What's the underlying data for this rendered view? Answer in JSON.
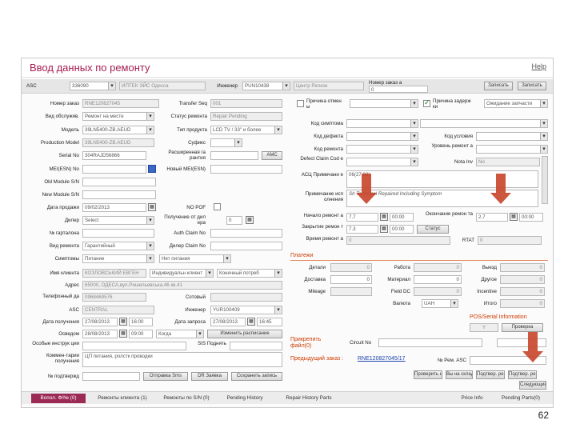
{
  "window": {
    "title": "Ввод данных по ремонту",
    "help": "Help"
  },
  "topbar": {
    "asc_label": "ASC",
    "asc_code": "336090",
    "asc_name": "ИПТЕК ЭЙС Одесса",
    "engineer_label": "Инженер",
    "engineer_code": "PUN10438",
    "engineer_name": "Центр Регион",
    "order_label": "Номер заказ а",
    "order_value": "0",
    "btn1": "Записать",
    "btn2": "Записать"
  },
  "left": {
    "claim_no_label": "Номер заказ",
    "claim_no": "RNE120827045",
    "transfer_label": "Transfer Seq",
    "transfer_val": "001",
    "service_type_label": "Вид обслужив.",
    "service_type": "Ремонт на месте",
    "repair_status_label": "Статус ремонта",
    "repair_status": "Repair Pending",
    "model_label": "Модель",
    "model": "39LN5400-ZB.AEUD",
    "product_label": "Тип продукта",
    "product": "LCD TV / 33\" и более",
    "prod_model_label": "Production Model",
    "prod_model": "39LN5400-ZB.AEUD",
    "suffix_label": "Суфикс",
    "serial_label": "Serial No",
    "serial": "304RAJD56866",
    "extended_warranty_label": "Расширенная га рантия",
    "amc": "AMC",
    "imei_label": "MEI(ESN) No",
    "new_imei_label": "Новый MEI(ESN)",
    "old_module_label": "Old Module S/N",
    "new_module_label": "New Module S/N",
    "sale_date_label": "Дата продажи",
    "sale_date": "09/02/2013",
    "no_pof_label": "NO POF",
    "dealer_label": "Дилер",
    "dealer": "Select",
    "received_from_label": "Получение от дил ера",
    "received_from_val": "0",
    "tally_label": "№ гарталона",
    "auth_label": "Auth Claim No",
    "return_label": "Вид ремонта",
    "return_val": "Гарантийный",
    "repair_kind_label": "Дилер Claim No",
    "symptom_label": "Симптомы",
    "symptom1": "Питание",
    "symptom2": "Нет питания"
  },
  "client": {
    "name_label": "Имя клиента",
    "name": "КОЗЛОВСЬКИЙ ЕВГЕН",
    "type": "Индивидуальн клиент",
    "final": "Конечный потреб",
    "addr_label": "Адрес",
    "addr": "65000, ОДЕСА,вул.Ришельевська,46 кв.41",
    "phone_label": "Телефонный да",
    "phone": "0968469576",
    "mobile_label": "Сотовый",
    "asc2_label": "ASC",
    "asc2": "CENTRAL",
    "engineer2_label": "Инженер",
    "engineer2": "YUR100409",
    "date_recv_label": "Дата получения",
    "date_recv": "27/08/2013",
    "time_recv": "16:00",
    "date_req_label": "Дата запроса",
    "date_req": "27/08/2013",
    "time_req": "16:45",
    "visit_label": "Осведом",
    "visit_date": "28/08/2013",
    "visit_time": "09:00",
    "visit_val": "Когда",
    "change_sched": "Изменить расписание",
    "special_label": "Особые инструк ции",
    "special_rec_label": "SIS Поднять",
    "comments_label": "Коммен-тарии получения",
    "comments": "ЦП питания, ролстк проводки",
    "confirm_label": "№ подтвержд",
    "btn_sms": "Отправка Sms",
    "btn_dr": "DR Заявка",
    "btn_save": "Сохранить запись"
  },
  "right": {
    "reason_stop_label": "Причина отмен ы",
    "reason_delay_label": "Причина задерж ки",
    "reason_delay": "Ожидание запчасти",
    "symptom_code_label": "Код симптома",
    "defect_code_label": "Код дефекта",
    "condition_label": "Код условия",
    "repair_code_label": "Код ремонта",
    "repair_level_label": "Уровень ремонт а",
    "defect_coll_label": "Defect Claim Cod e",
    "note_label": "Nota Inv",
    "note_val": "No",
    "asc_note_label": "АСЦ Примечани е",
    "asc_note": "06(27.08)",
    "comment_label": "Примечание исп олнения",
    "comment": "Sh Technical Repaired Including Symptom",
    "complete_date_label": "Начало ремонт а",
    "complete_date": "7.7",
    "complete_time": "00:00",
    "finish_date_label": "Окончание ремон та",
    "finish_date": "2.7",
    "finish_time": "00:00",
    "close_label": "Закрытие ремон т",
    "close_date": "7.3",
    "close_time": "00:00",
    "close_status": "Статус",
    "repair_time_label": "Время ремонт а",
    "repair_time": "0",
    "rtat_label": "RTAT",
    "rtat": "0",
    "payment_title": "Платежи",
    "labor_label": "Работа",
    "labor": "0",
    "trip_label": "Выезд",
    "trip": "0",
    "delivery_label": "Доставка",
    "delivery": "0",
    "parts_label": "Материал",
    "parts": "0",
    "other_label": "Другое",
    "other": "0",
    "mileage_label": "Mileage",
    "field_dc_label": "Field DC",
    "field_dc": "0",
    "incentive_label": "Incentive",
    "incentive": "0",
    "currency_label": "Валюта",
    "currency": "UAH",
    "total_label": "Итого",
    "total": "0",
    "detail_label": "Детали",
    "detail": "0",
    "pos_title": "POS/Serial Information",
    "pos_val": "Y",
    "pos_btn": "Проверка",
    "attach_label": "Прикрепить файл(0)",
    "circuit_label": "Circuit No",
    "prev_claim_label": "Предыдущий заказ :",
    "prev_claim": "RNE120827045/17",
    "no_rep_label": "№ Рем. ASC",
    "buttons": [
      "Проверить на OCS",
      "Вы на складе",
      "Подтвер. ремонт",
      "Подтвер. ремонт",
      "Следующий"
    ]
  },
  "tabs": [
    "Вопол. Ф/№ (0)",
    "Ремонты клиента (1)",
    "Ремонты по S/N (0)",
    "Pending History",
    "Repair History Parts",
    "Price Info",
    "Pending Parts(0)"
  ],
  "page_number": "62"
}
